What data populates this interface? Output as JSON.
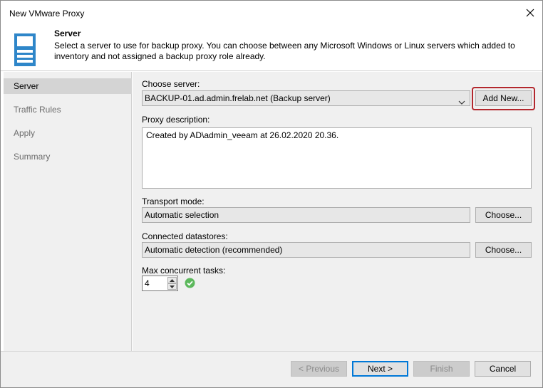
{
  "window": {
    "title": "New VMware Proxy",
    "close_icon": "close-icon"
  },
  "header": {
    "title": "Server",
    "description": "Select a server to use for backup proxy. You can choose between any Microsoft Windows or Linux servers which added to inventory and not assigned a backup proxy role already.",
    "icon": "server-icon"
  },
  "sidebar": {
    "items": [
      {
        "label": "Server",
        "active": true
      },
      {
        "label": "Traffic Rules",
        "active": false
      },
      {
        "label": "Apply",
        "active": false
      },
      {
        "label": "Summary",
        "active": false
      }
    ]
  },
  "form": {
    "choose_server_label": "Choose server:",
    "choose_server_value": "BACKUP-01.ad.admin.frelab.net (Backup server)",
    "add_new_label": "Add New...",
    "proxy_description_label": "Proxy description:",
    "proxy_description_value": "Created by AD\\admin_veeam at 26.02.2020 20.36.",
    "transport_mode_label": "Transport mode:",
    "transport_mode_value": "Automatic selection",
    "transport_choose_label": "Choose...",
    "datastores_label": "Connected datastores:",
    "datastores_value": "Automatic detection (recommended)",
    "datastores_choose_label": "Choose...",
    "max_tasks_label": "Max concurrent tasks:",
    "max_tasks_value": "4",
    "status_icon": "check-circle-icon"
  },
  "footer": {
    "previous_label": "< Previous",
    "next_label": "Next >",
    "finish_label": "Finish",
    "cancel_label": "Cancel"
  },
  "colors": {
    "highlight": "#b3272d",
    "primary_border": "#0078d7",
    "ok_green": "#5cb85c",
    "server_icon_blue": "#2e86c9"
  }
}
